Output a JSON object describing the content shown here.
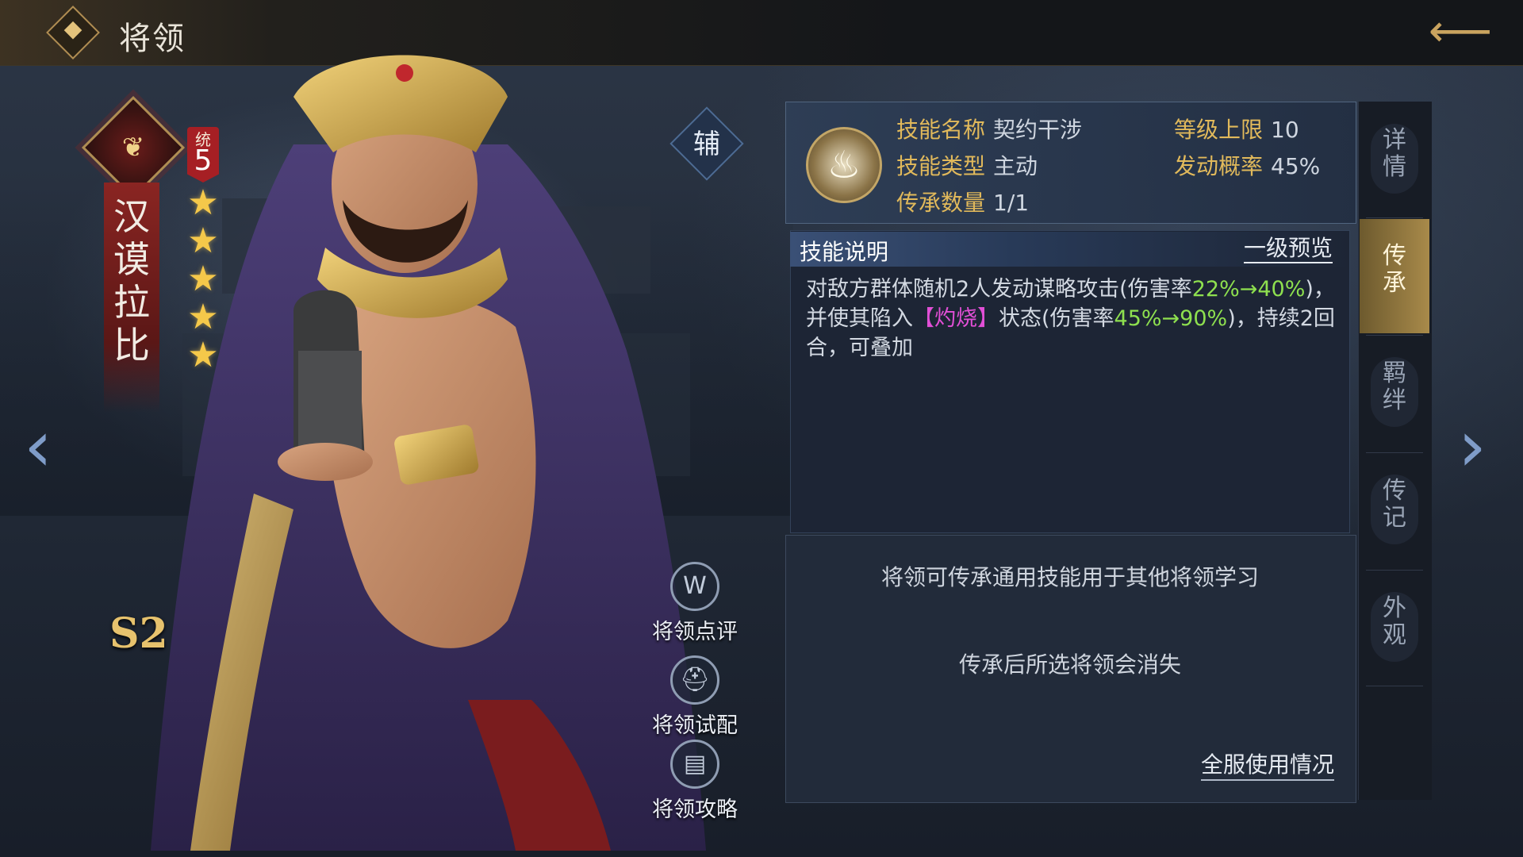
{
  "header": {
    "title": "将领",
    "back_icon": "back-arrow-icon"
  },
  "hero": {
    "name": "汉谟拉比",
    "tong_label": "统",
    "tong_value": "5",
    "stars": 5,
    "season": "S2",
    "role": "辅"
  },
  "actions": [
    {
      "label": "将领点评",
      "icon": "review-icon"
    },
    {
      "label": "将领试配",
      "icon": "helmet-icon"
    },
    {
      "label": "将领攻略",
      "icon": "book-icon"
    }
  ],
  "skill": {
    "name_key": "技能名称",
    "name_value": "契约干涉",
    "type_key": "技能类型",
    "type_value": "主动",
    "inherit_key": "传承数量",
    "inherit_value": "1/1",
    "level_key": "等级上限",
    "level_value": "10",
    "chance_key": "发动概率",
    "chance_value": "45%"
  },
  "description": {
    "title": "技能说明",
    "preview_link": "一级预览",
    "text_1": "对敌方群体随机2人发动谋略攻击(伤害率",
    "text_2": "22%→40%",
    "text_3": ")，并使其陷入",
    "text_4": "【灼烧】",
    "text_5": "状态(伤害率",
    "text_6": "45%→90%",
    "text_7": ")，持续2回合，可叠加"
  },
  "info": {
    "line1": "将领可传承通用技能用于其他将领学习",
    "line2": "传承后所选将领会消失",
    "usage_link": "全服使用情况"
  },
  "tabs": [
    {
      "label": "详情",
      "active": false
    },
    {
      "label": "传承",
      "active": true
    },
    {
      "label": "羁绊",
      "active": false
    },
    {
      "label": "传记",
      "active": false
    },
    {
      "label": "外观",
      "active": false
    }
  ],
  "colors": {
    "accent_gold": "#e1b95b",
    "highlight_green": "#8ee04f",
    "highlight_magenta": "#e14fd6"
  }
}
